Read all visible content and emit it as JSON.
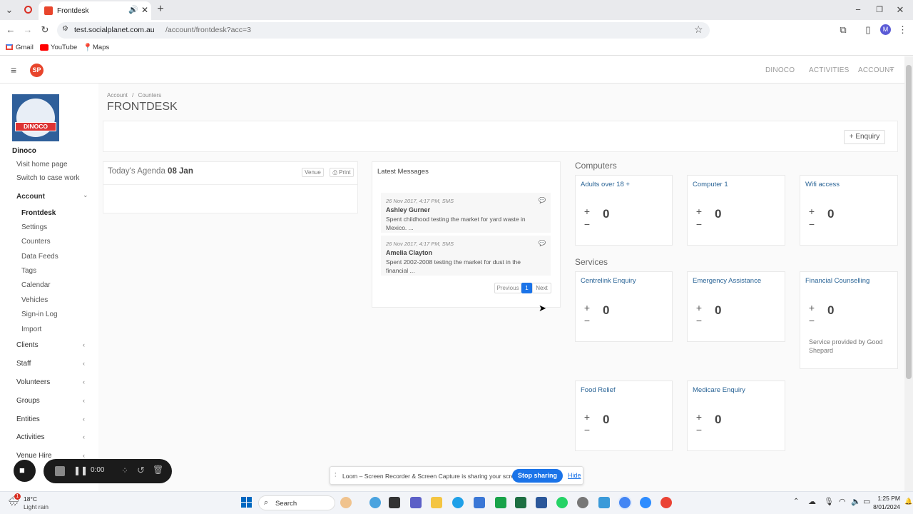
{
  "browser": {
    "tab_title": "Frontdesk",
    "url_host": "test.socialplanet.com.au",
    "url_path": "/account/frontdesk?acc=3",
    "bookmarks": [
      "Gmail",
      "YouTube",
      "Maps"
    ],
    "profile_initial": "M"
  },
  "app": {
    "nav": [
      "DINOCO",
      "ACTIVITIES",
      "ACCOUNT"
    ],
    "logo_text": "DINOCO",
    "org_name": "Dinoco",
    "breadcrumb": [
      "Account",
      "Counters"
    ],
    "page_title": "FRONTDESK",
    "enquiry_button": "Enquiry",
    "sidebar": {
      "links": [
        "Visit home page",
        "Switch to case work"
      ],
      "account_label": "Account",
      "account_items": [
        "Frontdesk",
        "Settings",
        "Counters",
        "Data Feeds",
        "Tags",
        "Calendar",
        "Vehicles",
        "Sign-in Log",
        "Import"
      ],
      "sections": [
        "Clients",
        "Staff",
        "Volunteers",
        "Groups",
        "Entities",
        "Activities",
        "Venue Hire"
      ]
    },
    "agenda": {
      "title_prefix": "Today's Agenda",
      "date": "08 Jan",
      "venue_label": "Venue",
      "print_label": "Print"
    },
    "messages": {
      "title": "Latest Messages",
      "items": [
        {
          "meta": "26 Nov 2017, 4:17 PM, SMS",
          "name": "Ashley Gurner",
          "text": "Spent childhood testing the market for yard waste in Mexico. ..."
        },
        {
          "meta": "26 Nov 2017, 4:17 PM, SMS",
          "name": "Amelia Clayton",
          "text": "Spent 2002-2008 testing the market for dust in the financial ..."
        }
      ],
      "pagination": {
        "previous": "Previous",
        "page": "1",
        "next": "Next"
      }
    },
    "computers": {
      "heading": "Computers",
      "counters": [
        {
          "title": "Adults over 18 +",
          "value": "0"
        },
        {
          "title": "Computer 1",
          "value": "0"
        },
        {
          "title": "Wifi access",
          "value": "0"
        }
      ]
    },
    "services": {
      "heading": "Services",
      "counters": [
        {
          "title": "Centrelink Enquiry",
          "value": "0"
        },
        {
          "title": "Emergency Assistance",
          "value": "0"
        },
        {
          "title": "Financial Counselling",
          "value": "0",
          "note": "Service provided by Good Shepard"
        },
        {
          "title": "Food Relief",
          "value": "0"
        },
        {
          "title": "Medicare Enquiry",
          "value": "0"
        }
      ]
    }
  },
  "loom": {
    "timer": "0:00",
    "share_text": "Loom – Screen Recorder & Screen Capture is sharing your screen.",
    "stop_label": "Stop sharing",
    "hide_label": "Hide"
  },
  "taskbar": {
    "weather_temp": "18°C",
    "weather_desc": "Light rain",
    "search_label": "Search",
    "time": "1:25 PM",
    "date": "8/01/2024"
  },
  "colors": {
    "link_blue": "#2a6496",
    "accent_blue": "#1a73e8",
    "logo_red": "#e8452c",
    "loom_blue": "#1a73e8",
    "win_blue": "#0067c0"
  }
}
